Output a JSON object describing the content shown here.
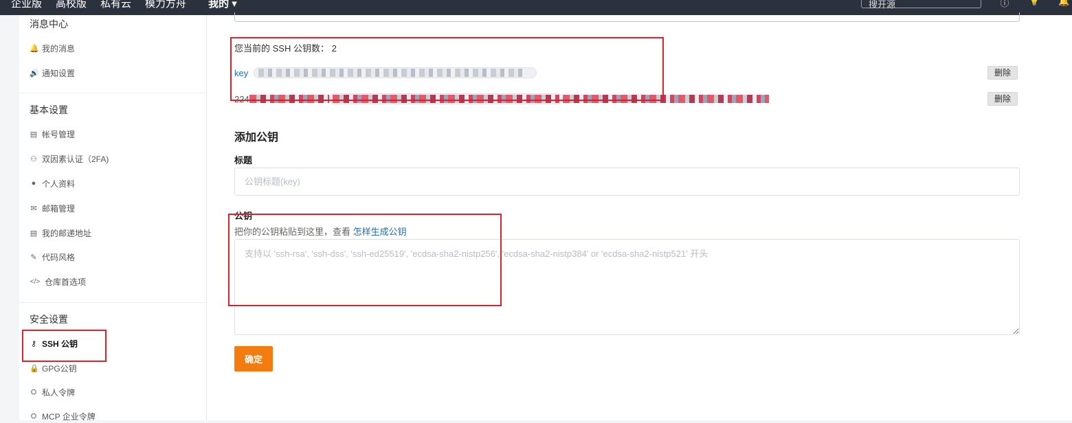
{
  "topbar": {
    "nav": [
      "企业版",
      "高校版",
      "私有云",
      "模力方舟"
    ],
    "mine": "我的 ▾",
    "search_placeholder": "搜开源",
    "icons": [
      "info-icon",
      "bulb-icon",
      "bell-icon"
    ]
  },
  "sidebar": {
    "sections": [
      {
        "title": "消息中心",
        "items": [
          {
            "label": "我的消息",
            "icon": "bell-icon",
            "glyph": "🔔"
          },
          {
            "label": "通知设置",
            "icon": "speaker-icon",
            "glyph": "🔊"
          }
        ]
      },
      {
        "title": "基本设置",
        "items": [
          {
            "label": "帐号管理",
            "icon": "id-card-icon",
            "glyph": "▤"
          },
          {
            "label": "双因素认证（2FA)",
            "icon": "user-shield-icon",
            "glyph": "⚇"
          },
          {
            "label": "个人资料",
            "icon": "user-icon",
            "glyph": "●"
          },
          {
            "label": "邮箱管理",
            "icon": "envelope-icon",
            "glyph": "✉"
          },
          {
            "label": "我的邮递地址",
            "icon": "address-card-icon",
            "glyph": "▤"
          },
          {
            "label": "代码风格",
            "icon": "brush-icon",
            "glyph": "✎"
          },
          {
            "label": "仓库首选项",
            "icon": "code-icon",
            "glyph": "</>"
          }
        ]
      },
      {
        "title": "安全设置",
        "items": [
          {
            "label": "SSH 公钥",
            "icon": "key-icon",
            "glyph": "⚷",
            "active": true
          },
          {
            "label": "GPG公钥",
            "icon": "lock-icon",
            "glyph": "🔒"
          },
          {
            "label": "私人令牌",
            "icon": "token-icon",
            "glyph": "⛭"
          },
          {
            "label": "MCP 企业令牌",
            "icon": "token-icon",
            "glyph": "⛭"
          }
        ]
      }
    ]
  },
  "main": {
    "ssh_count_label": "您当前的 SSH 公钥数： 2",
    "keys": [
      {
        "title": "key",
        "delete_label": "删除"
      },
      {
        "title": "224",
        "delete_label": "删除"
      }
    ],
    "add_heading": "添加公钥",
    "title_label": "标题",
    "title_placeholder": "公钥标题(key)",
    "key_label": "公钥",
    "key_hint": "把你的公钥粘贴到这里，查看 ",
    "key_hint_link": "怎样生成公钥",
    "key_placeholder": "支持以 'ssh-rsa', 'ssh-dss', 'ssh-ed25519', 'ecdsa-sha2-nistp256', 'ecdsa-sha2-nistp384' or 'ecdsa-sha2-nistp521' 开头",
    "confirm_label": "确定"
  },
  "colors": {
    "topbar": "#2c323d",
    "link": "#1f6fa8",
    "primary_button": "#f47b0d",
    "annotation_red": "#d9202c"
  }
}
